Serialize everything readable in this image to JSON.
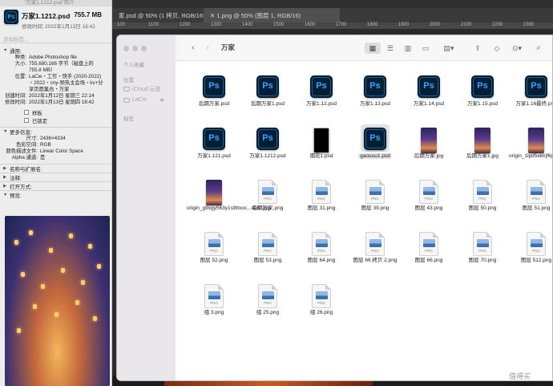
{
  "photoshop": {
    "tabs": [
      {
        "label": "家.psd @ 50% (1 拷贝, RGB/16*)"
      },
      {
        "label": "1.png @ 50% (图层 1, RGB/16)"
      }
    ],
    "ruler_ticks": [
      "100",
      "1100",
      "1200",
      "1300",
      "1400",
      "1500",
      "1600",
      "1700",
      "1800",
      "1900",
      "2000",
      "2100",
      "2200",
      "2300"
    ]
  },
  "info": {
    "window_title": "\"万家1.1212.psd\"简介",
    "filename": "万家1.1212.psd",
    "size": "755.7 MB",
    "modified_label": "修改时间:",
    "modified": "2022年1月13日 18:42",
    "tags_placeholder": "添加标签...",
    "general": {
      "title": "通用:",
      "rows": [
        {
          "k": "种类:",
          "v": "Adobe Photoshop file"
        },
        {
          "k": "大小:",
          "v": "755,680,166 字节（磁盘上的 755.8 MB）"
        },
        {
          "k": "位置:",
          "v": "LaCie・工作・快手 (2020-2022) ・2022・cny-预热主会场・kv+分享页面集合・万家"
        },
        {
          "k": "创建时间:",
          "v": "2022年1月12日 星期三 22:14"
        },
        {
          "k": "修改时间:",
          "v": "2022年1月13日 星期四 18:42"
        }
      ],
      "stationery": "样板",
      "locked": "已锁定"
    },
    "more": {
      "title": "更多信息:",
      "rows": [
        {
          "k": "尺寸:",
          "v": "2436×4334"
        },
        {
          "k": "色彩空间:",
          "v": "RGB"
        },
        {
          "k": "颜色描述文件:",
          "v": "Linear Color Space"
        },
        {
          "k": "Alpha 通道:",
          "v": "是"
        }
      ]
    },
    "name_ext": "名称与扩展名:",
    "comments": "注释:",
    "open_with": "打开方式:",
    "preview": "预览:"
  },
  "finder": {
    "title": "万家",
    "sidebar": {
      "section_personal": "个人收藏",
      "section_locations": "位置",
      "icloud": "iCloud 云盘",
      "lacie": "LaCie",
      "section_tags": "标签"
    },
    "files": [
      {
        "name": "后期万家.psd",
        "type": "ps"
      },
      {
        "name": "后期万家1.psd",
        "type": "ps"
      },
      {
        "name": "万家1.12.psd",
        "type": "ps"
      },
      {
        "name": "万家1.13.psd",
        "type": "ps"
      },
      {
        "name": "万家1.14.psd",
        "type": "ps"
      },
      {
        "name": "万家1.15.psd",
        "type": "ps"
      },
      {
        "name": "万家1.16最终.psd",
        "type": "ps"
      },
      {
        "name": "万家1.121.psd",
        "type": "ps"
      },
      {
        "name": "万家1.1212.psd",
        "type": "ps"
      },
      {
        "name": "烟花1.psd",
        "type": "black"
      },
      {
        "name": "gaouuu1.psd",
        "type": "ps",
        "selected": true
      },
      {
        "name": "后期万家.jpg",
        "type": "thumb"
      },
      {
        "name": "后期万家1.jpg",
        "type": "thumb"
      },
      {
        "name": "origin_1lpd5xklrjf6pfa6f...fnnfl.jpg",
        "type": "thumb"
      },
      {
        "name": "origin_g9xgy563y1s9ttxoc...4bhr.jpg",
        "type": "thumb"
      },
      {
        "name": "后期万家.png",
        "type": "png"
      },
      {
        "name": "图层 31.png",
        "type": "png"
      },
      {
        "name": "图层 39.png",
        "type": "png"
      },
      {
        "name": "图层 43.png",
        "type": "png"
      },
      {
        "name": "图层 50.png",
        "type": "png"
      },
      {
        "name": "图层 51.png",
        "type": "png"
      },
      {
        "name": "图层 52.png",
        "type": "png"
      },
      {
        "name": "图层 53.png",
        "type": "png"
      },
      {
        "name": "图层 64.png",
        "type": "png"
      },
      {
        "name": "图层 66 拷贝 2.png",
        "type": "png"
      },
      {
        "name": "图层 66.png",
        "type": "png"
      },
      {
        "name": "图层 70.png",
        "type": "png"
      },
      {
        "name": "图层 512.png",
        "type": "png"
      },
      {
        "name": "组 3.png",
        "type": "png"
      },
      {
        "name": "组 25.png",
        "type": "png"
      },
      {
        "name": "组 26.png",
        "type": "png"
      }
    ]
  },
  "watermark": "值得买"
}
